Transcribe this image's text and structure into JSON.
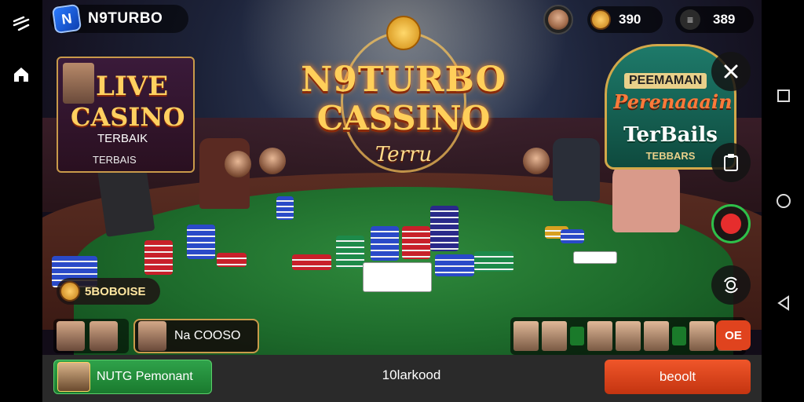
{
  "header": {
    "brand_name": "N9TURBO",
    "brand_logo_icon": "n9-logo-icon",
    "coins_value": "390",
    "gems_value": "389"
  },
  "title": {
    "line1": "N9TURBO",
    "line2": "CASSINO",
    "line3": "Terru"
  },
  "live_banner": {
    "line1": "LIVE",
    "line2": "CASINO",
    "line3": "TERBAIK",
    "line4": "TERBAIS"
  },
  "promo_banner": {
    "line1": "PEEMAMAN",
    "line2": "Perenaaain",
    "line3": "TerBails",
    "line4": "TEBBARS"
  },
  "bet": {
    "value": "5BOBOISE"
  },
  "player": {
    "name": "Na COOSO"
  },
  "bottom": {
    "left_button": "NUTG Pemonant",
    "center_text": "10larkood",
    "right_button": "beoolt"
  },
  "emote_button": "OE",
  "colors": {
    "felt": "#1d6a2b",
    "title_gold": "#ffcf5a",
    "orange_button": "#e0431e",
    "green_button": "#2fa24a",
    "record_ring": "#2ec04a",
    "record_dot": "#e62d2d"
  },
  "icons": [
    "menu-icon",
    "home-icon",
    "close-icon",
    "clipboard-icon",
    "record-icon",
    "camera-flip-icon",
    "square-nav-icon",
    "circle-nav-icon",
    "back-nav-icon",
    "coin-icon",
    "chip-stack-icon"
  ]
}
